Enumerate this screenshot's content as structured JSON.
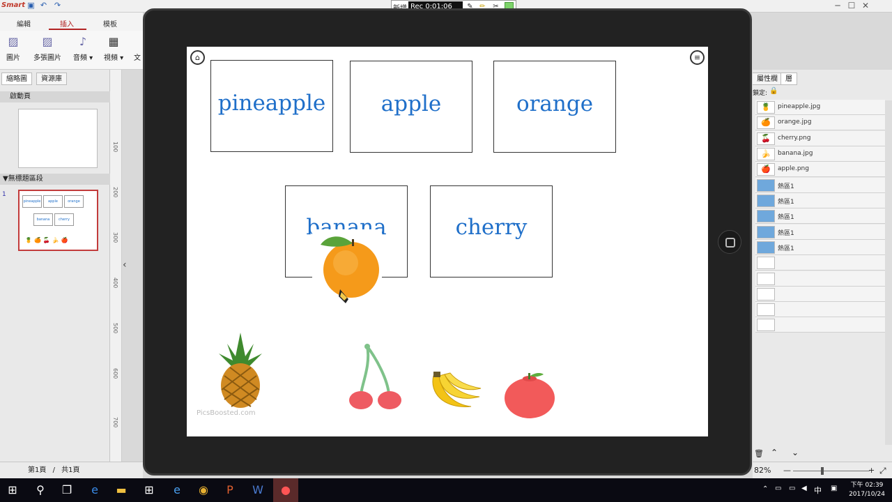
{
  "app": {
    "logo": "Smart",
    "quick_icons": [
      "save-icon",
      "undo-icon",
      "redo-icon"
    ]
  },
  "recorder": {
    "title": "新增",
    "time": "Rec 0:01:06"
  },
  "ribbon": {
    "tabs": [
      "編輯",
      "插入",
      "模板"
    ],
    "active_tab": "插入",
    "buttons": [
      {
        "label": "圖片"
      },
      {
        "label": "多張圖片"
      },
      {
        "label": "音頻 ▾"
      },
      {
        "label": "視頻 ▾"
      },
      {
        "label": "文"
      }
    ]
  },
  "left_panel": {
    "tabs": [
      "縮略圖",
      "資源庫"
    ],
    "section1": "啟動頁",
    "section2": "▼無標題區段",
    "slide_number": "1",
    "mini_words": [
      "pineapple",
      "apple",
      "orange",
      "banana",
      "cherry"
    ]
  },
  "ruler": {
    "ticks": [
      "100",
      "200",
      "300",
      "400",
      "500",
      "600",
      "700"
    ]
  },
  "status": {
    "page": "第1頁",
    "separator": "/",
    "total": "共1頁"
  },
  "canvas": {
    "words": [
      "pineapple",
      "apple",
      "orange",
      "banana",
      "cherry"
    ],
    "watermark": "PicsBoosted.com"
  },
  "right_panel": {
    "tabs": [
      "屬性欄",
      "層"
    ],
    "lock_label": "鎖定:",
    "layers": [
      "pineapple.jpg",
      "orange.jpg",
      "cherry.png",
      "banana.jpg",
      "apple.png",
      "熱區1",
      "熱區1",
      "熱區1",
      "熱區1",
      "熱區1",
      "",
      "",
      "",
      "",
      ""
    ]
  },
  "zoom": {
    "value": "82%",
    "minus": "—",
    "plus": "+"
  },
  "taskbar": {
    "time": "下午 02:39",
    "date": "2017/10/24",
    "ime": "中"
  },
  "colors": {
    "word_text": "#1f6fc9",
    "tablet": "#222222",
    "taskbar": "#0a0a12"
  }
}
